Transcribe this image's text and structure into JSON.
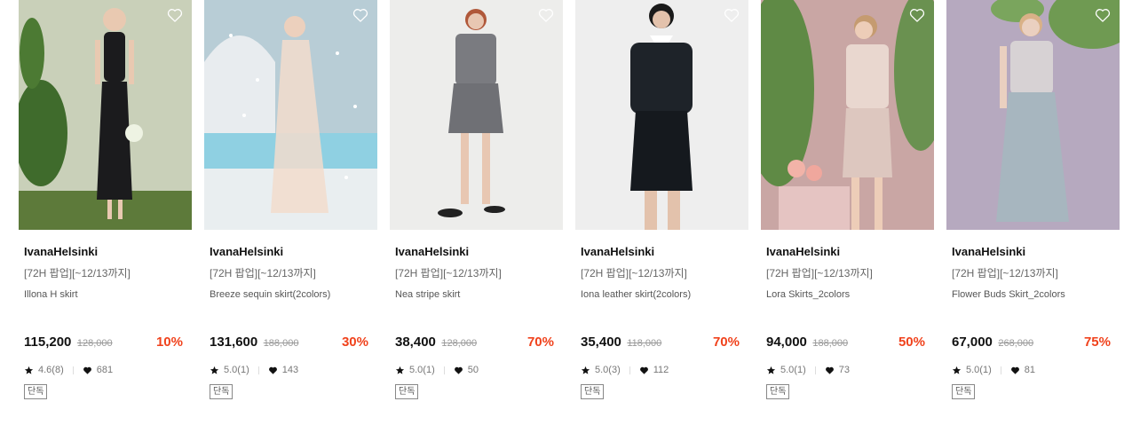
{
  "products": [
    {
      "brand": "IvanaHelsinki",
      "promo": "[72H 팝업][~12/13까지]",
      "name": "Illona H skirt",
      "price": "115,200",
      "original_price": "128,000",
      "discount": "10%",
      "rating": "4.6(8)",
      "likes": "681",
      "tag": "단독",
      "photo_colors": {
        "bg": "#c9d0b9",
        "floor": "#5d7a3a",
        "garment": "#1b1b1d",
        "skin": "#e9c9b1"
      }
    },
    {
      "brand": "IvanaHelsinki",
      "promo": "[72H 팝업][~12/13까지]",
      "name": "Breeze sequin skirt(2colors)",
      "price": "131,600",
      "original_price": "188,000",
      "discount": "30%",
      "rating": "5.0(1)",
      "likes": "143",
      "tag": "단독",
      "photo_colors": {
        "bg": "#b8cdd6",
        "floor": "#8fd0e2",
        "garment": "#f2dccd",
        "skin": "#ecd0bd"
      }
    },
    {
      "brand": "IvanaHelsinki",
      "promo": "[72H 팝업][~12/13까지]",
      "name": "Nea stripe skirt",
      "price": "38,400",
      "original_price": "128,000",
      "discount": "70%",
      "rating": "5.0(1)",
      "likes": "50",
      "tag": "단독",
      "photo_colors": {
        "bg": "#ededeb",
        "floor": "#e4e4e2",
        "garment": "#7a7b80",
        "skin": "#e8c7b2"
      }
    },
    {
      "brand": "IvanaHelsinki",
      "promo": "[72H 팝업][~12/13까지]",
      "name": "Iona leather skirt(2colors)",
      "price": "35,400",
      "original_price": "118,000",
      "discount": "70%",
      "rating": "5.0(3)",
      "likes": "112",
      "tag": "단독",
      "photo_colors": {
        "bg": "#eeeeee",
        "floor": "#e6e6e6",
        "garment": "#1e2329",
        "skin": "#e3c2ac"
      }
    },
    {
      "brand": "IvanaHelsinki",
      "promo": "[72H 팝업][~12/13까지]",
      "name": "Lora Skirts_2colors",
      "price": "94,000",
      "original_price": "188,000",
      "discount": "50%",
      "rating": "5.0(1)",
      "likes": "73",
      "tag": "단독",
      "photo_colors": {
        "bg": "#c9a6a4",
        "floor": "#d8b6b0",
        "garment": "#e9d7cf",
        "skin": "#edcdb8"
      }
    },
    {
      "brand": "IvanaHelsinki",
      "promo": "[72H 팝업][~12/13까지]",
      "name": "Flower Buds Skirt_2colors",
      "price": "67,000",
      "original_price": "268,000",
      "discount": "75%",
      "rating": "5.0(1)",
      "likes": "81",
      "tag": "단독",
      "photo_colors": {
        "bg": "#b6a9bf",
        "floor": "#b09fb6",
        "garment": "#a7b6bf",
        "skin": "#ead0c0"
      }
    }
  ],
  "colors": {
    "discount": "#f0421c",
    "text": "#111111",
    "muted": "#999999"
  },
  "icons": {
    "wishlist": "heart-outline-icon",
    "rating": "star-icon",
    "likes": "heart-filled-icon"
  }
}
